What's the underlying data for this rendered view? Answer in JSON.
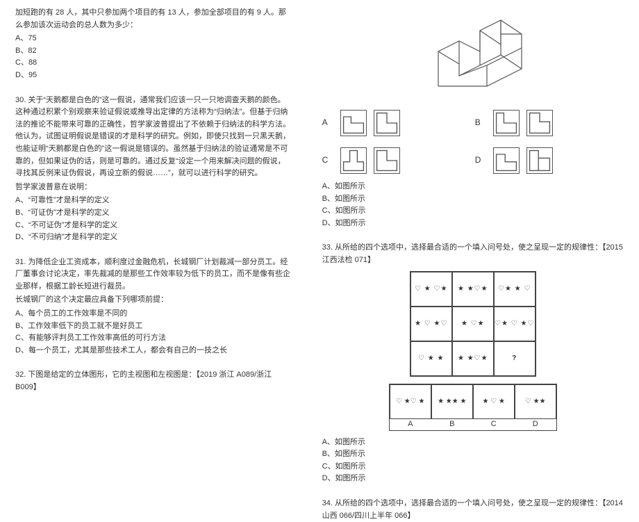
{
  "left": {
    "q29": {
      "text": "加短跑的有 28 人，其中只参加两个项目的有 13 人，参加全部项目的有 9 人。那么参加该次运动会的总人数为多少：",
      "choices": {
        "A": "A、75",
        "B": "B、82",
        "C": "C、88",
        "D": "D、95"
      }
    },
    "q30": {
      "text": "30. 关于“天鹅都是白色的”这一假说，通常我们应该一只一只地调查天鹅的颜色。这种通过积累个别观察来验证假说或推导出定律的方法称为“归纳法”。但基于归纳法的推论不能带来可靠的正确性，哲学家波普提出了不依赖于归纳法的科学方法。他认为，试图证明假说是错误的才是科学的研究。例如，即使只找到一只黑天鹅，也能证明“天鹅都是白色的”这一假说是错误的。虽然基于归纳法的验证通常是不可靠的，但如果证伪的话，则是可靠的。通过反复“设定一个用来解决问题的假说，寻找其反例来证伪假说，再设立新的假说……”，就可以进行科学的研究。",
      "sub": "哲学家波普意在说明：",
      "choices": {
        "A": "A、“可靠性”才是科学的定义",
        "B": "B、“可证伪”才是科学的定义",
        "C": "C、“不可证伪”才是科学的定义",
        "D": "D、“不可归纳”才是科学的定义"
      }
    },
    "q31": {
      "text": "31. 为降低企业工资成本，顺利度过金融危机，长城钢厂计划裁减一部分员工。经厂董事会讨论决定，率先裁减的是那些工作效率较为低下的员工，而不是像有些企业那样，根据工龄长短进行裁员。",
      "sub": "长城钢厂的这个决定最应具备下列哪项前提：",
      "choices": {
        "A": "A、每个员工的工作效率是不同的",
        "B": "B、工作效率低下的员工就不是好员工",
        "C": "C、有能够评判员工工作效率高低的可行方法",
        "D": "D、每一个员工，尤其是那些技术工人，都会有自己的一技之长"
      }
    },
    "q32": {
      "text": "32. 下图是给定的立体图形，它的主视图和左视图是：【2019 浙江 A089/浙江 B009】"
    }
  },
  "right": {
    "q32choices": {
      "A": "A、如图所示",
      "B": "B、如图所示",
      "C": "C、如图所示",
      "D": "D、如图所示"
    },
    "q33": {
      "text": "33. 从所给的四个选项中，选择最合适的一个填入问号处，使之呈现一定的规律性：【2015 江西法检 071】",
      "cells": [
        "♡ ★ ♡★",
        "★ ★♡★",
        "♡★ ★ ♡",
        "★ ♡ ★♡",
        "★ ♡★",
        "♡★ ♡ ★♡",
        "♡ ★ ★",
        "★ ★♡★",
        "?"
      ],
      "ans": [
        "♡ ★♡ ★",
        "★ ★★ ★",
        "★ ♡ ★",
        "♡ ★★"
      ],
      "ansLabels": [
        "A",
        "B",
        "C",
        "D"
      ],
      "choices": {
        "A": "A、如图所示",
        "B": "B、如图所示",
        "C": "C、如图所示",
        "D": "D、如图所示"
      }
    },
    "q34": {
      "text": "34. 从所给的四个选项中，选择最合适的一个填入问号处，使之呈现一定的规律性：【2014 山西 066/四川上半年 066】"
    }
  }
}
